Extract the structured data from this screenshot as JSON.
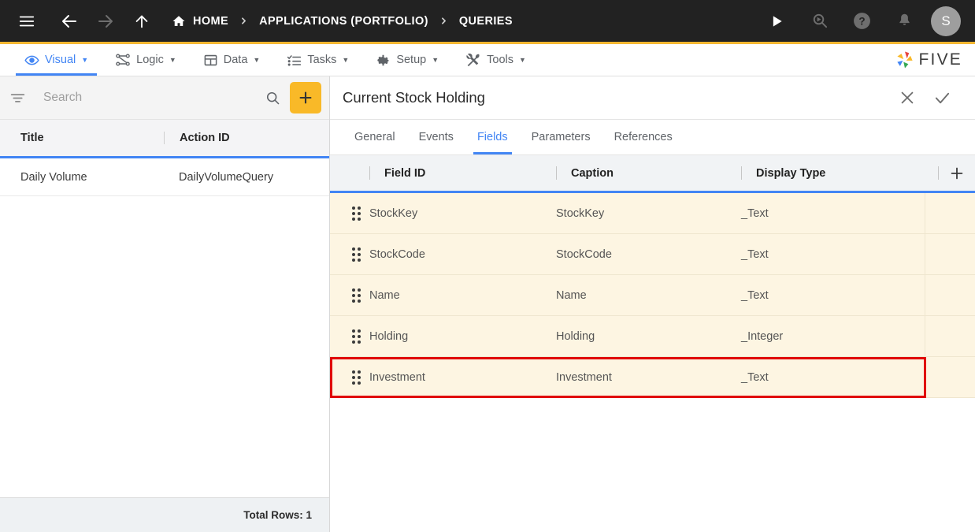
{
  "topbar": {
    "menu_icon": "hamburger-icon",
    "back_icon": "arrow-left-icon",
    "forward_icon": "arrow-right-icon",
    "up_icon": "arrow-up-icon",
    "home_icon": "home-icon",
    "breadcrumbs": [
      "HOME",
      "APPLICATIONS (PORTFOLIO)",
      "QUERIES"
    ],
    "actions": [
      "run-icon",
      "search-run-icon",
      "help-icon",
      "notifications-icon"
    ],
    "avatar_initial": "S",
    "accent_color": "#F5B731",
    "background_color": "#222222"
  },
  "navbar": {
    "items": [
      {
        "label": "Visual",
        "icon": "eye-icon",
        "active": true
      },
      {
        "label": "Logic",
        "icon": "nodes-icon",
        "active": false
      },
      {
        "label": "Data",
        "icon": "grid-icon",
        "active": false
      },
      {
        "label": "Tasks",
        "icon": "checklist-icon",
        "active": false
      },
      {
        "label": "Setup",
        "icon": "gear-icon",
        "active": false
      },
      {
        "label": "Tools",
        "icon": "tools-icon",
        "active": false
      }
    ],
    "caret": "▼",
    "brand": "FIVE",
    "active_color": "#4285F4"
  },
  "sidebar": {
    "search": {
      "placeholder": "Search",
      "value": ""
    },
    "filter_icon": "filter-icon",
    "search_icon": "search-icon",
    "add_label": "+",
    "columns": [
      "Title",
      "Action ID"
    ],
    "rows": [
      {
        "title": "Daily Volume",
        "action_id": "DailyVolumeQuery"
      }
    ],
    "footer": "Total Rows: 1"
  },
  "detail": {
    "title": "Current Stock Holding",
    "close_icon": "close-icon",
    "confirm_icon": "check-icon",
    "tabs": [
      {
        "label": "General",
        "active": false
      },
      {
        "label": "Events",
        "active": false
      },
      {
        "label": "Fields",
        "active": true
      },
      {
        "label": "Parameters",
        "active": false
      },
      {
        "label": "References",
        "active": false
      }
    ],
    "grid": {
      "columns": [
        "Field ID",
        "Caption",
        "Display Type"
      ],
      "add_label": "+",
      "rows": [
        {
          "field_id": "StockKey",
          "caption": "StockKey",
          "display_type": "_Text",
          "highlighted": false
        },
        {
          "field_id": "StockCode",
          "caption": "StockCode",
          "display_type": "_Text",
          "highlighted": false
        },
        {
          "field_id": "Name",
          "caption": "Name",
          "display_type": "_Text",
          "highlighted": false
        },
        {
          "field_id": "Holding",
          "caption": "Holding",
          "display_type": "_Integer",
          "highlighted": false
        },
        {
          "field_id": "Investment",
          "caption": "Investment",
          "display_type": "_Text",
          "highlighted": true
        }
      ],
      "row_background": "#FDF5E2",
      "highlight_color": "#E00000"
    }
  }
}
